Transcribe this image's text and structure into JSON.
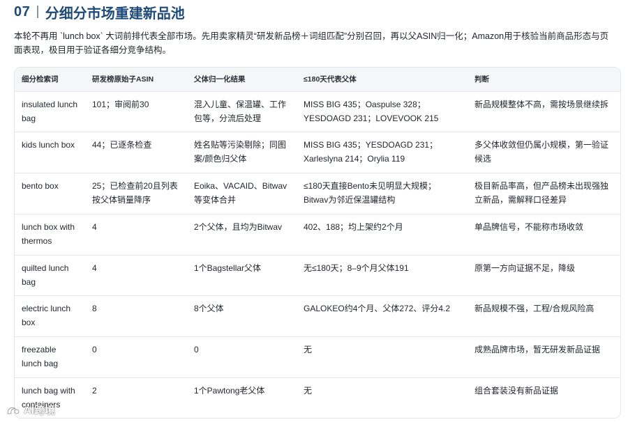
{
  "section": {
    "number": "07",
    "title": "分细分市场重建新品池"
  },
  "intro": "本轮不再用 `lunch box` 大词前排代表全部市场。先用卖家精灵“研发新品榜＋词组匹配”分别召回，再以父ASIN归一化；Amazon用于核验当前商品形态与页面表现，极目用于验证各细分竞争结构。",
  "table": {
    "headers": [
      "细分检索词",
      "研发榜原始子ASIN",
      "父体归一化结果",
      "≤180天代表父体",
      "判断"
    ],
    "rows": [
      [
        "insulated lunch bag",
        "101；审阅前30",
        "混入儿童、保温罐、工作包等，分流后处理",
        "MISS BIG 435；Oaspulse 328；YESDOAGD 231；LOVEVOOK 215",
        "新品规模整体不高，需按场景继续拆"
      ],
      [
        "kids lunch box",
        "44；已逐条检查",
        "姓名贴等污染剔除；同图案/颜色归父体",
        "MISS BIG 435；YESDOAGD 231；Xarleslyna 214；Orylia 119",
        "多父体收敛但仍属小规模，第一验证候选"
      ],
      [
        "bento box",
        "25；已检查前20且列表按父体销量降序",
        "Eoika、VACAID、Bitwav等变体合并",
        "≤180天直接Bento未见明显大规模；Bitwav为邻近保温罐结构",
        "极目新品率高，但产品榜未出现强独立新品，需解释口径差异"
      ],
      [
        "lunch box with thermos",
        "4",
        "2个父体，且均为Bitwav",
        "402、188；均上架约2个月",
        "单品牌信号，不能称市场收敛"
      ],
      [
        "quilted lunch bag",
        "4",
        "1个Bagstellar父体",
        "无≤180天；8–9个月父体191",
        "原第一方向证据不足，降级"
      ],
      [
        "electric lunch box",
        "8",
        "8个父体",
        "GALOKEO约4个月、父体272、评分4.2",
        "新品规模不强，工程/合规风险高"
      ],
      [
        "freezable lunch bag",
        "0",
        "0",
        "无",
        "成熟品牌市场，暂无研发新品证据"
      ],
      [
        "lunch bag with containers",
        "2",
        "1个Pawtong老父体",
        "无",
        "组合套装没有新品证据"
      ]
    ]
  },
  "watermark": "AI跨境"
}
